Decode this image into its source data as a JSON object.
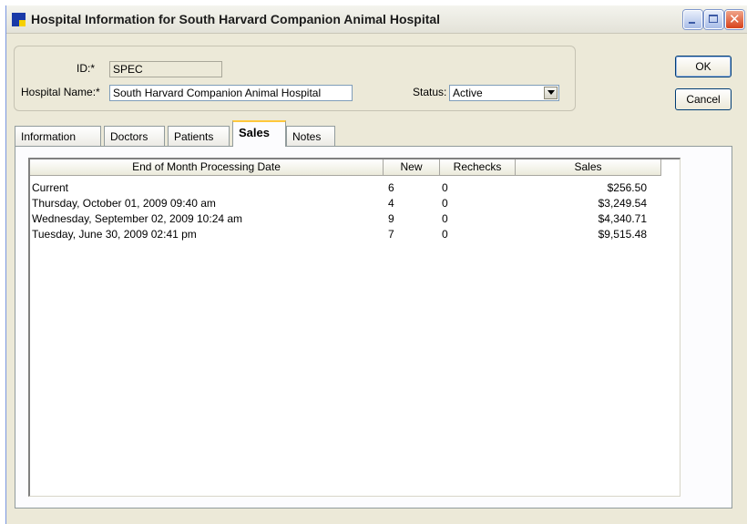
{
  "window": {
    "title": "Hospital Information for South Harvard Companion Animal Hospital"
  },
  "form": {
    "id_label": "ID:*",
    "id_value": "SPEC",
    "name_label": "Hospital Name:*",
    "name_value": "South Harvard Companion Animal Hospital",
    "status_label": "Status:",
    "status_value": "Active"
  },
  "buttons": {
    "ok": "OK",
    "cancel": "Cancel"
  },
  "tabs": [
    "Information",
    "Doctors",
    "Patients",
    "Sales",
    "Notes"
  ],
  "active_tab": "Sales",
  "table": {
    "columns": [
      "End of Month Processing Date",
      "New",
      "Rechecks",
      "Sales"
    ],
    "rows": [
      {
        "date": "Current",
        "new": "6",
        "rechecks": "0",
        "sales": "$256.50"
      },
      {
        "date": "Thursday, October 01, 2009 09:40 am",
        "new": "4",
        "rechecks": "0",
        "sales": "$3,249.54"
      },
      {
        "date": "Wednesday, September 02, 2009 10:24 am",
        "new": "9",
        "rechecks": "0",
        "sales": "$4,340.71"
      },
      {
        "date": "Tuesday, June 30, 2009 02:41 pm",
        "new": "7",
        "rechecks": "0",
        "sales": "$9,515.48"
      }
    ]
  },
  "colors": {
    "window_bg": "#ece9d8",
    "tab_highlight": "#ffc83c",
    "title_icon": "#1a3aa8"
  }
}
